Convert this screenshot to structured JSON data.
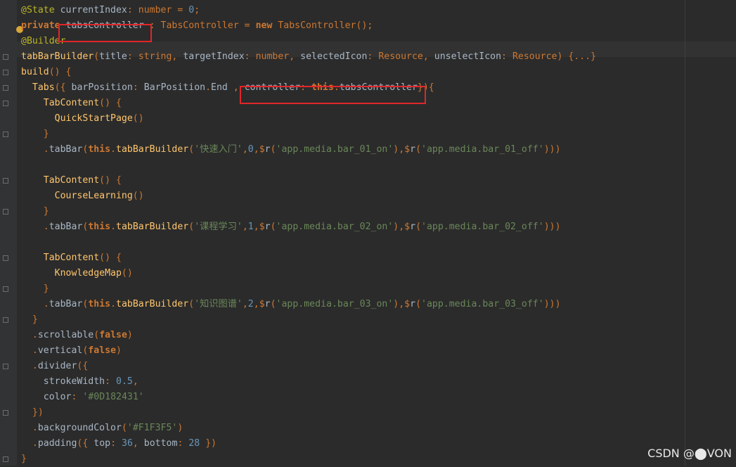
{
  "editor": {
    "lines": [
      "@State currentIndex: number = 0;",
      "private tabsController : TabsController = new TabsController();",
      "@Builder",
      "tabBarBuilder(title: string, targetIndex: number, selectedIcon: Resource, unselectIcon: Resource) {...}",
      "build() {",
      "  Tabs({ barPosition: BarPosition.End , controller: this.tabsController}){",
      "    TabContent() {",
      "      QuickStartPage()",
      "    }",
      "    .tabBar(this.tabBarBuilder('快速入门',0,$r('app.media.bar_01_on'),$r('app.media.bar_01_off')))",
      "",
      "    TabContent() {",
      "      CourseLearning()",
      "    }",
      "    .tabBar(this.tabBarBuilder('课程学习',1,$r('app.media.bar_02_on'),$r('app.media.bar_02_off')))",
      "",
      "    TabContent() {",
      "      KnowledgeMap()",
      "    }",
      "    .tabBar(this.tabBarBuilder('知识图谱',2,$r('app.media.bar_03_on'),$r('app.media.bar_03_off')))",
      "  }",
      "  .scrollable(false)",
      "  .vertical(false)",
      "  .divider({",
      "    strokeWidth: 0.5,",
      "    color: '#0D182431'",
      "  })",
      "  .backgroundColor('#F1F3F5')",
      "  .padding({ top: 36, bottom: 28 })",
      "}"
    ]
  },
  "watermark": "CSDN @⬤VON",
  "colors": {
    "background": "#2b2b2b",
    "highlight_box": "#e0262a",
    "keyword": "#cc7832",
    "string": "#6a8759",
    "number": "#6897bb",
    "annotation": "#bbb529",
    "function": "#ffc66d"
  }
}
